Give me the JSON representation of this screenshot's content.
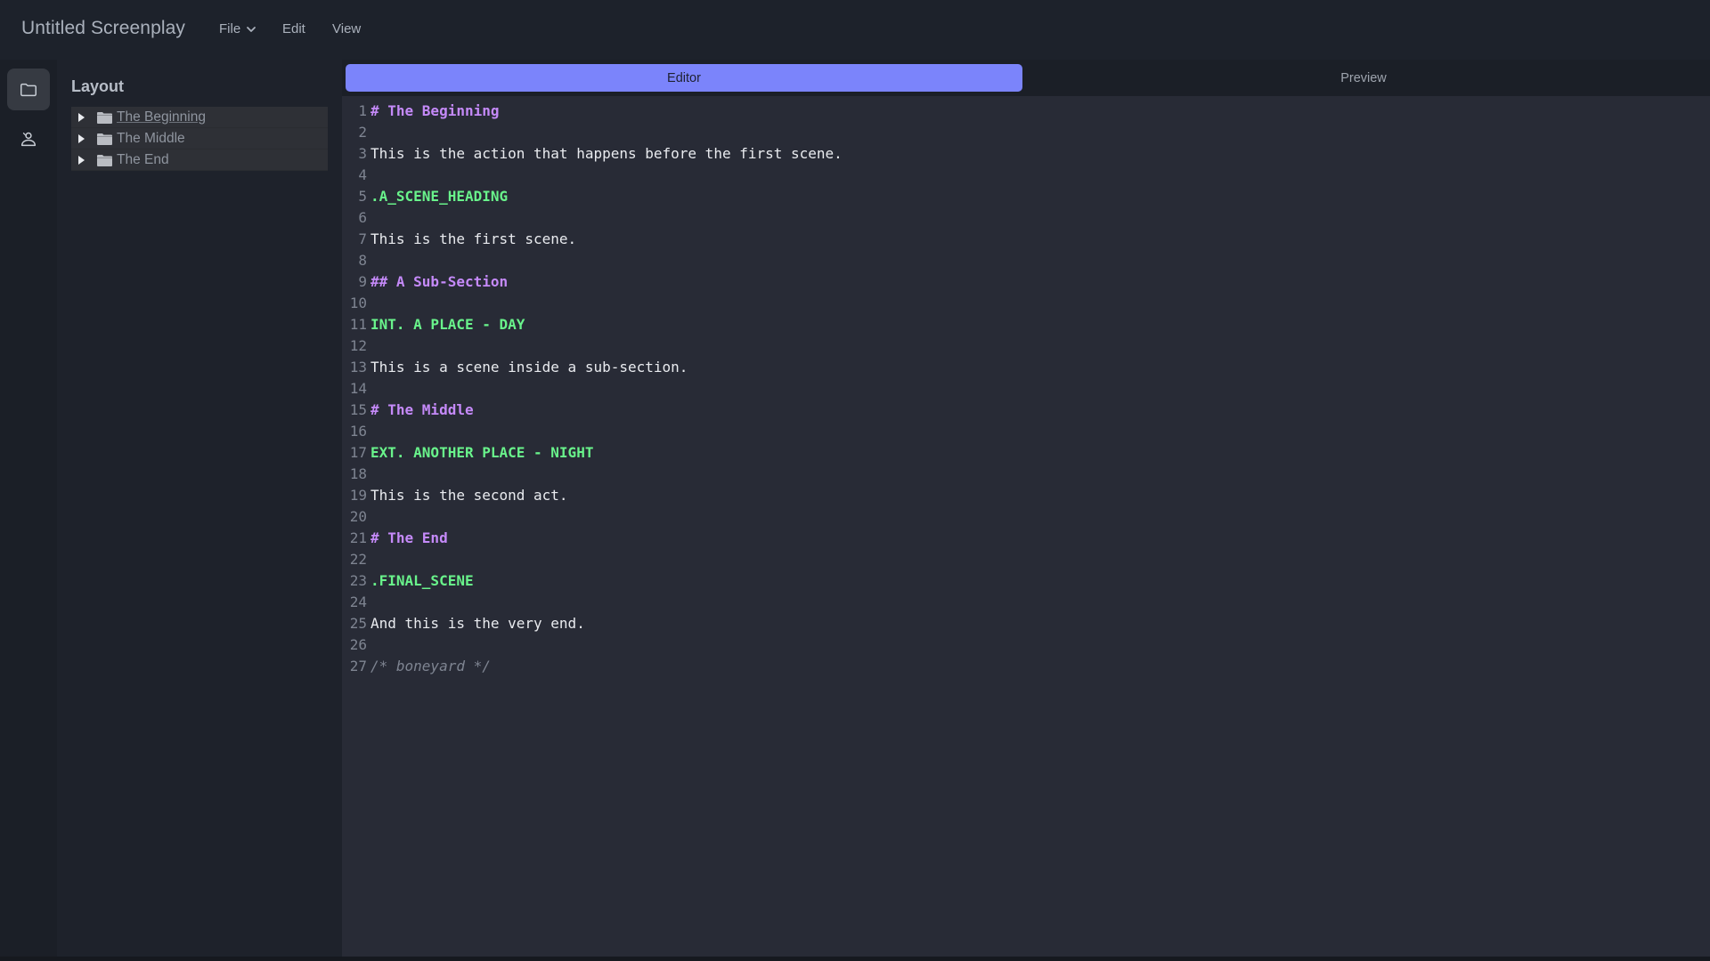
{
  "app": {
    "title": "Untitled Screenplay"
  },
  "menu": {
    "file": "File",
    "edit": "Edit",
    "view": "View"
  },
  "sidebar": {
    "title": "Layout",
    "items": [
      {
        "label": "The Beginning"
      },
      {
        "label": "The Middle"
      },
      {
        "label": "The End"
      }
    ]
  },
  "tabs": {
    "editor": "Editor",
    "preview": "Preview",
    "active": "Editor"
  },
  "colors": {
    "accent": "#7b84fb",
    "section": "#c58af9",
    "scene": "#69f38b",
    "action": "#e9ebef",
    "comment": "#7e8491"
  },
  "icons": {
    "rail_top": "folder-icon",
    "rail_bottom": "person-icon"
  },
  "editor": {
    "lines": [
      {
        "n": "1",
        "text": "# The Beginning",
        "kind": "section"
      },
      {
        "n": "2",
        "text": "",
        "kind": "blank"
      },
      {
        "n": "3",
        "text": "This is the action that happens before the first scene.",
        "kind": "action"
      },
      {
        "n": "4",
        "text": "",
        "kind": "blank"
      },
      {
        "n": "5",
        "text": ".A_SCENE_HEADING",
        "kind": "scene"
      },
      {
        "n": "6",
        "text": "",
        "kind": "blank"
      },
      {
        "n": "7",
        "text": "This is the first scene.",
        "kind": "action"
      },
      {
        "n": "8",
        "text": "",
        "kind": "blank"
      },
      {
        "n": "9",
        "text": "## A Sub-Section",
        "kind": "section"
      },
      {
        "n": "10",
        "text": "",
        "kind": "blank"
      },
      {
        "n": "11",
        "text": "INT. A PLACE - DAY",
        "kind": "scene"
      },
      {
        "n": "12",
        "text": "",
        "kind": "blank"
      },
      {
        "n": "13",
        "text": "This is a scene inside a sub-section.",
        "kind": "action"
      },
      {
        "n": "14",
        "text": "",
        "kind": "blank"
      },
      {
        "n": "15",
        "text": "# The Middle",
        "kind": "section"
      },
      {
        "n": "16",
        "text": "",
        "kind": "blank"
      },
      {
        "n": "17",
        "text": "EXT. ANOTHER PLACE - NIGHT",
        "kind": "scene"
      },
      {
        "n": "18",
        "text": "",
        "kind": "blank"
      },
      {
        "n": "19",
        "text": "This is the second act.",
        "kind": "action"
      },
      {
        "n": "20",
        "text": "",
        "kind": "blank"
      },
      {
        "n": "21",
        "text": "# The End",
        "kind": "section"
      },
      {
        "n": "22",
        "text": "",
        "kind": "blank"
      },
      {
        "n": "23",
        "text": ".FINAL_SCENE",
        "kind": "scene"
      },
      {
        "n": "24",
        "text": "",
        "kind": "blank"
      },
      {
        "n": "25",
        "text": "And this is the very end.",
        "kind": "action"
      },
      {
        "n": "26",
        "text": "",
        "kind": "blank"
      },
      {
        "n": "27",
        "text": "/* boneyard */",
        "kind": "comment"
      }
    ]
  }
}
